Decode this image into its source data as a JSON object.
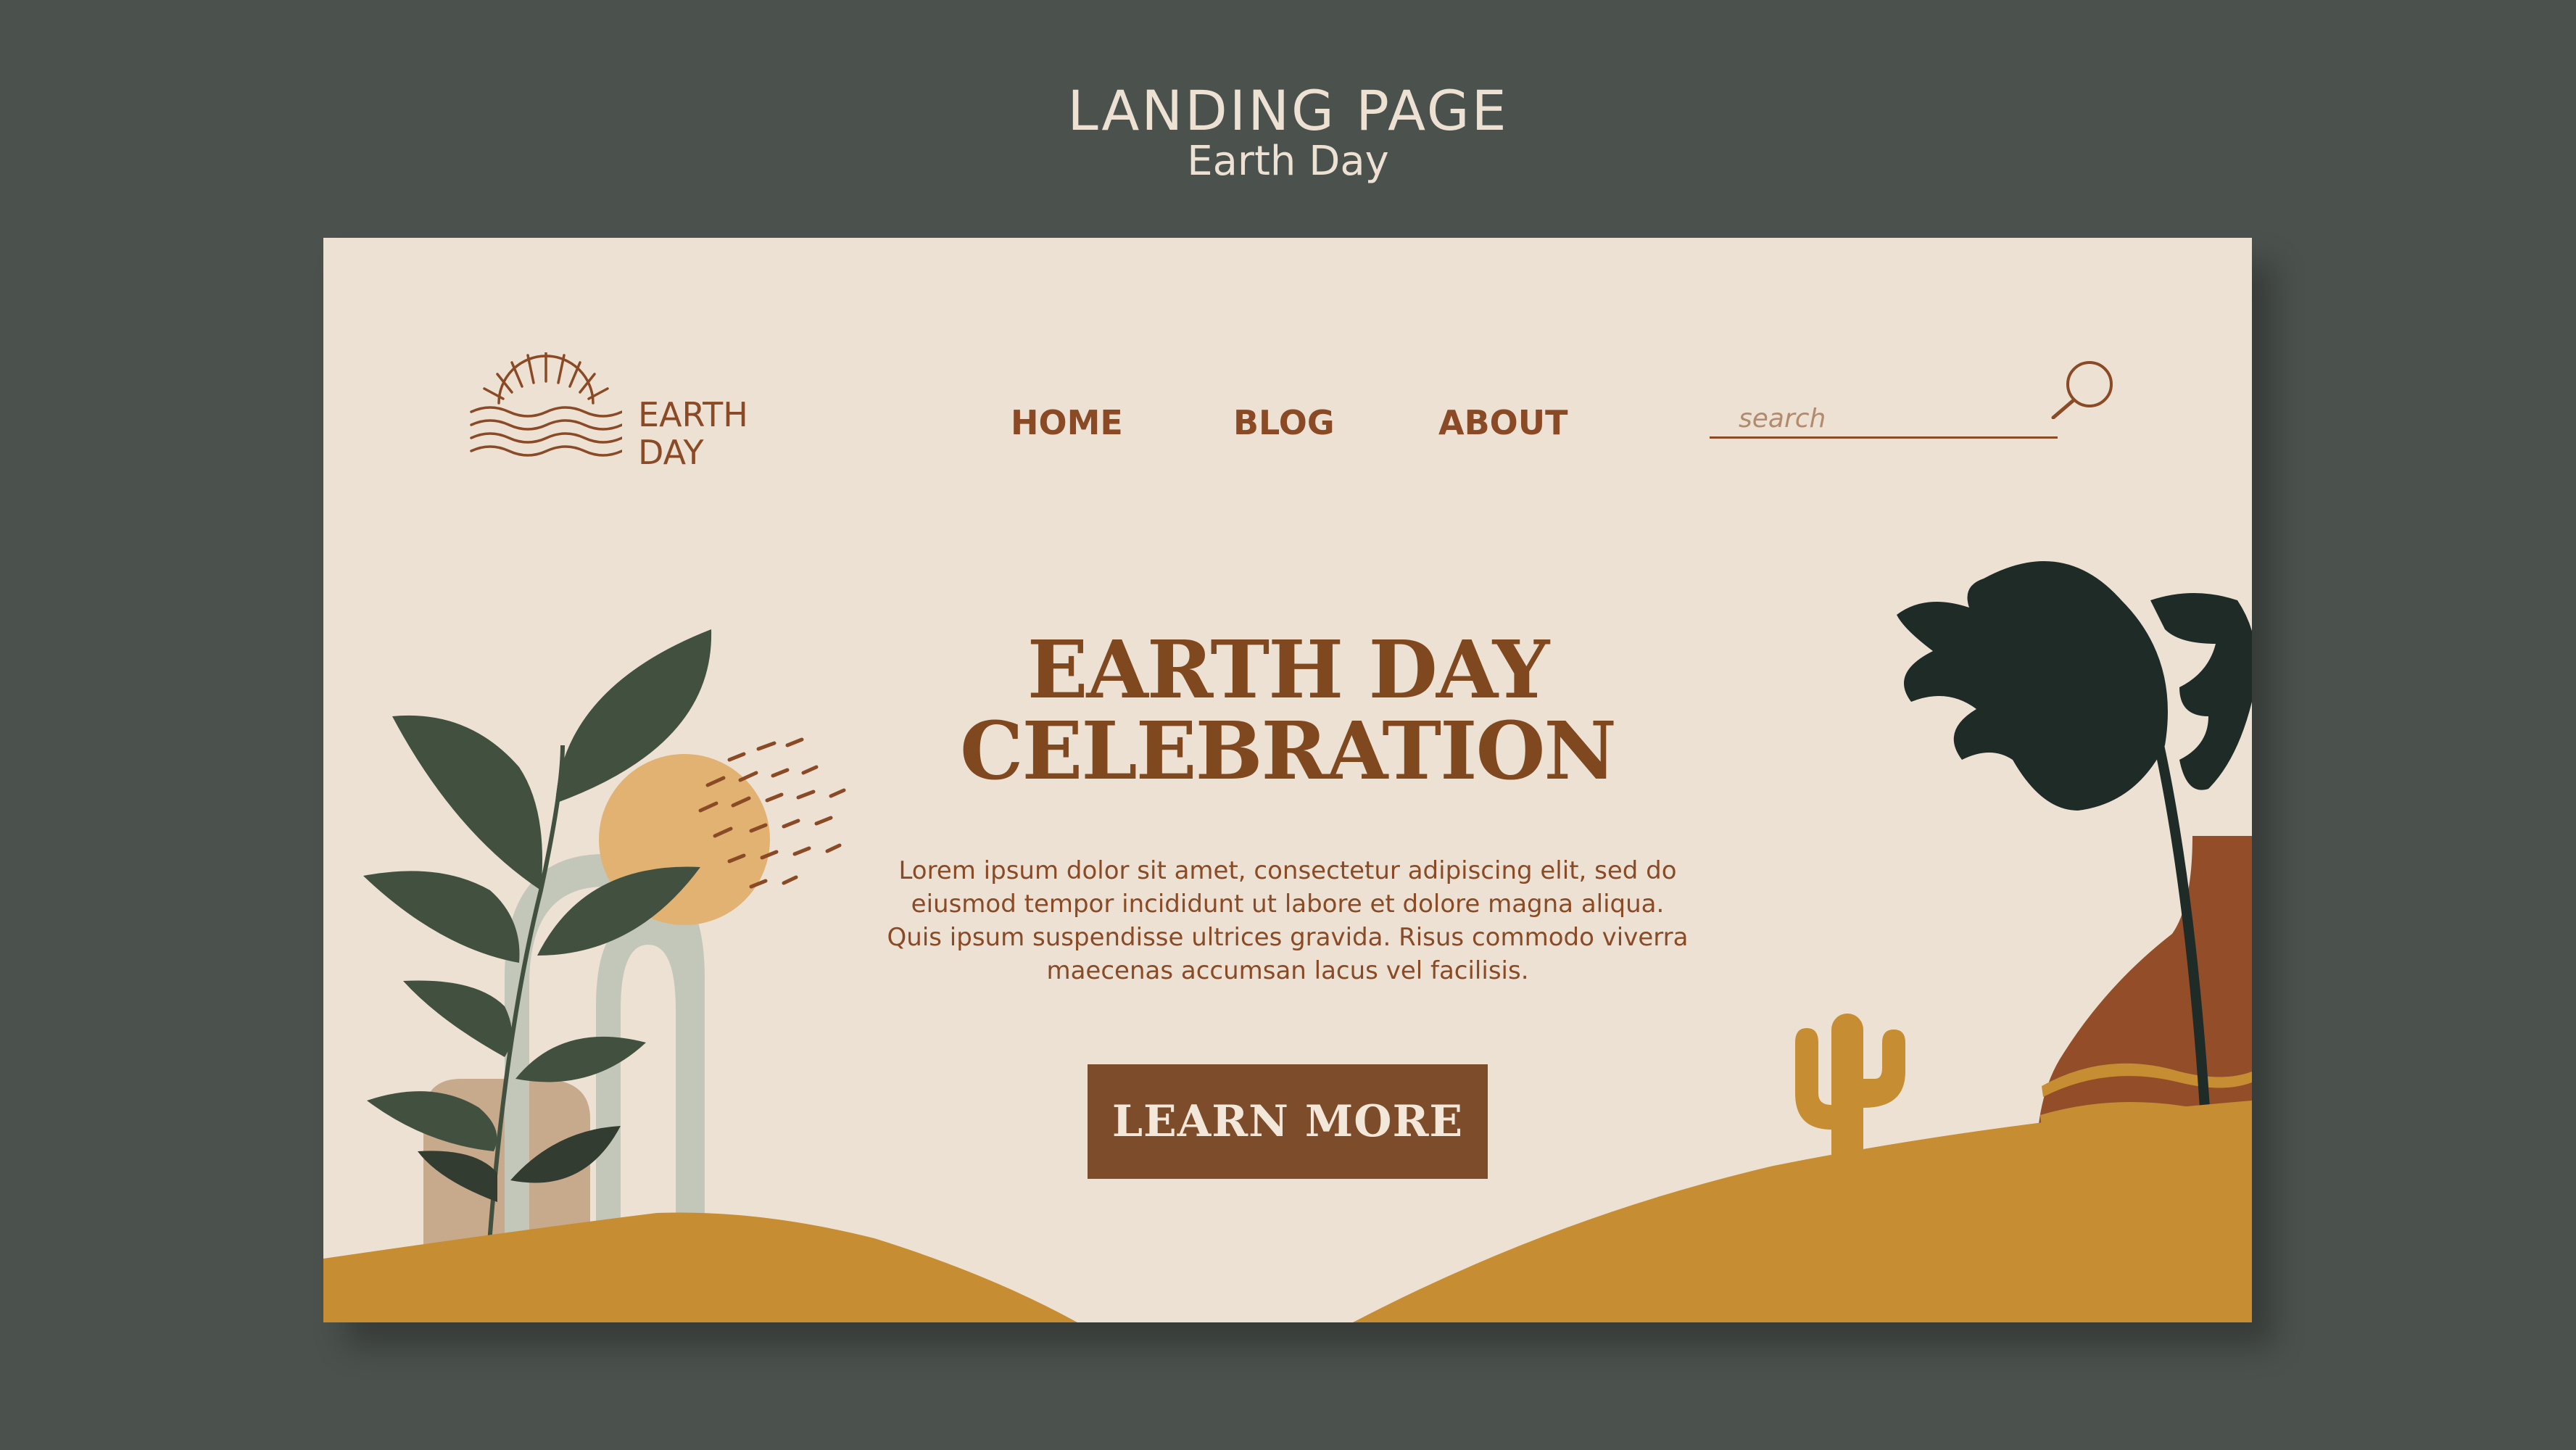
{
  "header": {
    "title": "LANDING PAGE",
    "subtitle": "Earth Day"
  },
  "logo": {
    "line1": "EARTH",
    "line2": "DAY",
    "icon": "sunrise-waves-icon"
  },
  "nav": {
    "items": [
      {
        "label": "HOME"
      },
      {
        "label": "BLOG"
      },
      {
        "label": "ABOUT"
      }
    ]
  },
  "search": {
    "placeholder": "search",
    "icon": "search-icon"
  },
  "hero": {
    "title_line1": "EARTH DAY",
    "title_line2": "CELEBRATION",
    "body": "Lorem ipsum dolor sit amet, consectetur adipiscing elit, sed do eiusmod tempor incididunt ut labore et dolore magna aliqua. Quis ipsum suspendisse ultrices gravida. Risus commodo viverra maecenas accumsan lacus vel facilisis.",
    "cta_label": "LEARN MORE"
  },
  "colors": {
    "background": "#4b524d",
    "page": "#ede1d4",
    "brown": "#80481f",
    "mustard": "#c68d33",
    "sage": "#c3c7b9",
    "dark_leaf": "#425040",
    "monstera": "#1f2b27"
  }
}
